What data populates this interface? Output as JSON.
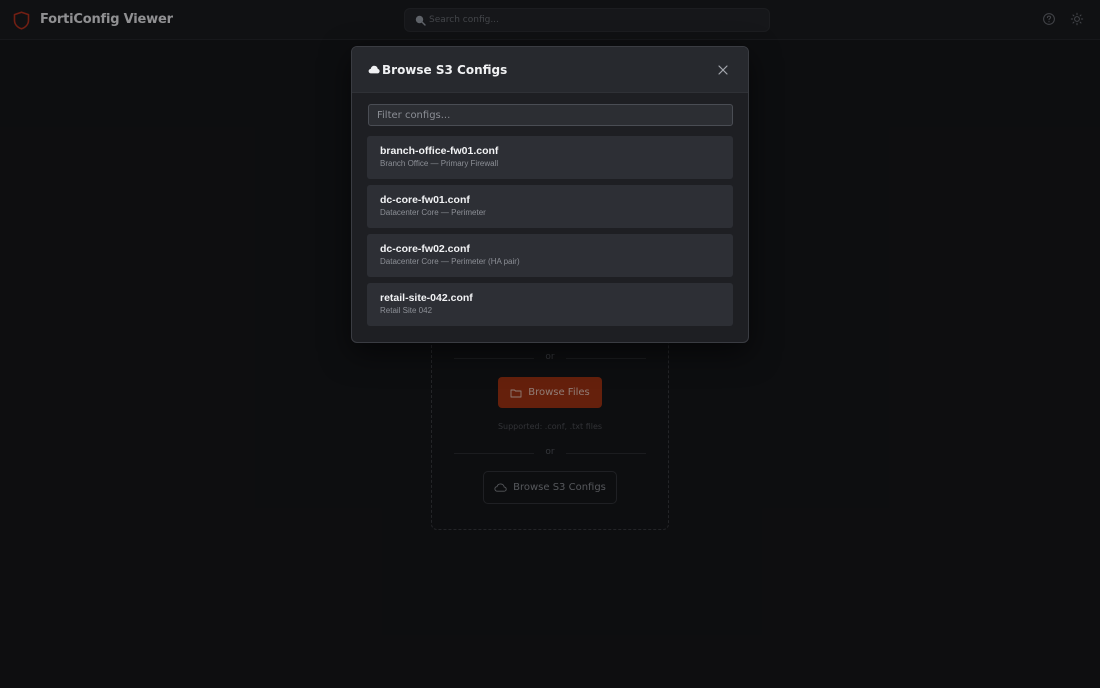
{
  "app": {
    "title": "FortiConfig Viewer"
  },
  "search": {
    "placeholder": "Search config..."
  },
  "dropzone": {
    "or_top": "or",
    "browse_files_label": "Browse Files",
    "supported_text": "Supported: .conf, .txt files",
    "or_bottom": "or",
    "browse_s3_label": "Browse S3 Configs"
  },
  "modal": {
    "title": "Browse S3 Configs",
    "filter_placeholder": "Filter configs...",
    "configs": [
      {
        "name": "branch-office-fw01.conf",
        "description": "Branch Office — Primary Firewall"
      },
      {
        "name": "dc-core-fw01.conf",
        "description": "Datacenter Core — Perimeter"
      },
      {
        "name": "dc-core-fw02.conf",
        "description": "Datacenter Core — Perimeter (HA pair)"
      },
      {
        "name": "retail-site-042.conf",
        "description": "Retail Site 042"
      }
    ]
  },
  "colors": {
    "accent": "#a33414",
    "logo": "#c0392b",
    "background": "#16171a",
    "modal_bg": "#1e1f23"
  },
  "icons": {
    "logo": "shield-icon",
    "search": "search-icon",
    "help": "help-circle-icon",
    "theme": "sun-icon",
    "modal": "cloud-icon",
    "close": "close-icon",
    "browse_files": "folder-icon",
    "browse_s3": "cloud-icon"
  }
}
